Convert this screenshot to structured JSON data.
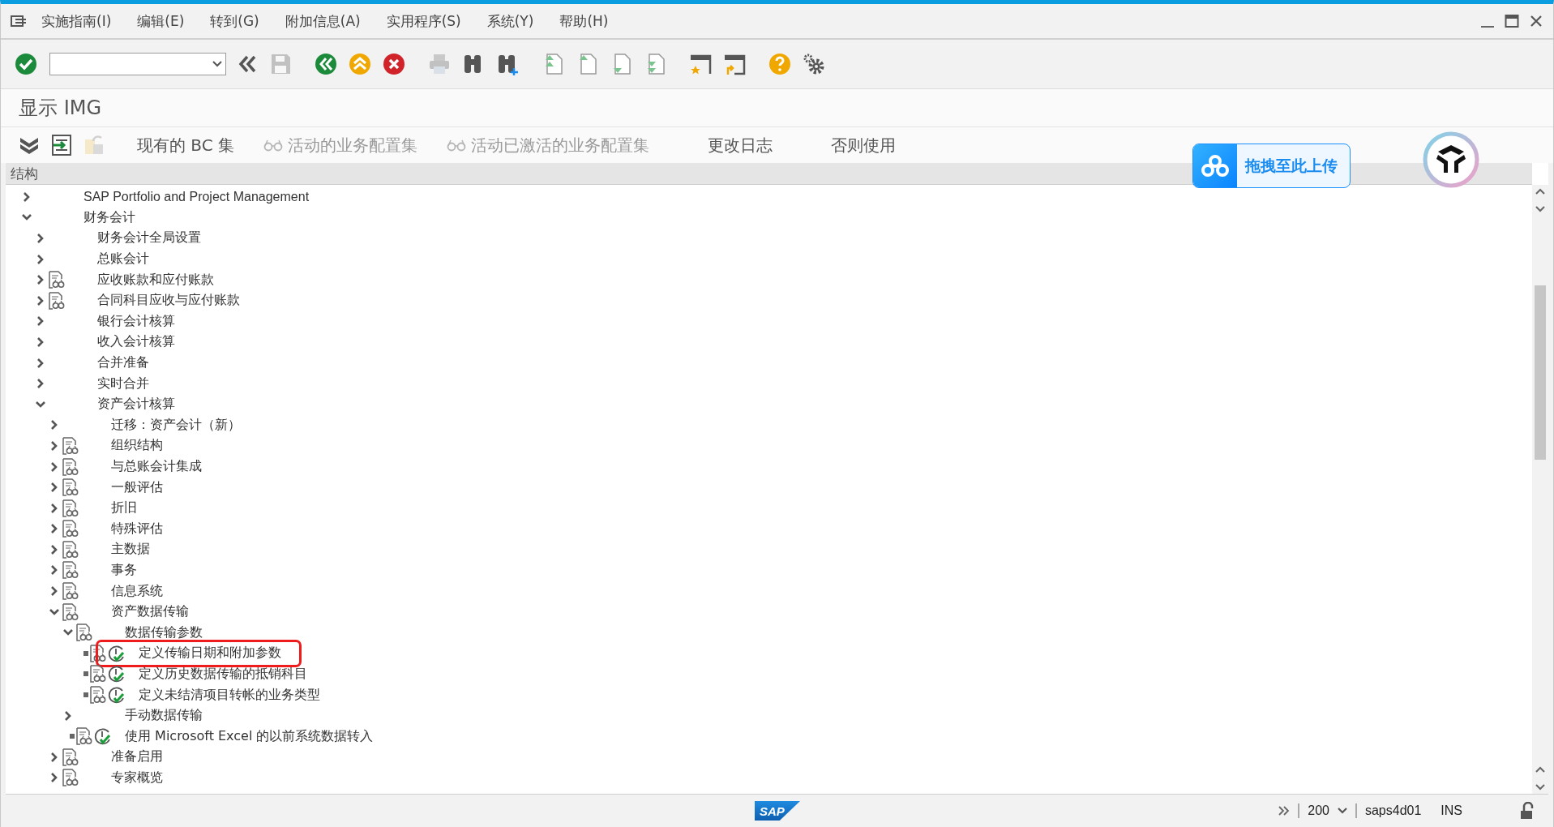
{
  "menu_bar": {
    "items": [
      "实施指南(I)",
      "编辑(E)",
      "转到(G)",
      "附加信息(A)",
      "实用程序(S)",
      "系统(Y)",
      "帮助(H)"
    ]
  },
  "toolbar": {
    "buttons": [
      {
        "kind": "enter",
        "disabled": false
      },
      {
        "kind": "command_field",
        "disabled": false
      },
      {
        "kind": "collapse",
        "disabled": false
      },
      {
        "kind": "save",
        "disabled": true
      },
      {
        "kind": "back",
        "disabled": false
      },
      {
        "kind": "exit",
        "disabled": false
      },
      {
        "kind": "cancel",
        "disabled": false
      },
      {
        "kind": "print",
        "disabled": true
      },
      {
        "kind": "find",
        "disabled": false
      },
      {
        "kind": "find_next",
        "disabled": false
      },
      {
        "kind": "first_page",
        "disabled": false
      },
      {
        "kind": "previous_page",
        "disabled": false
      },
      {
        "kind": "next_page",
        "disabled": false
      },
      {
        "kind": "last_page",
        "disabled": false
      },
      {
        "kind": "new_session",
        "disabled": false
      },
      {
        "kind": "shortcut",
        "disabled": false
      },
      {
        "kind": "help",
        "disabled": false
      },
      {
        "kind": "settings",
        "disabled": false
      }
    ]
  },
  "title": "显示 IMG",
  "app_toolbar": {
    "icon_buttons": [
      {
        "kind": "expand_all",
        "disabled": false
      },
      {
        "kind": "transfer",
        "disabled": false
      },
      {
        "kind": "export",
        "disabled": true
      }
    ],
    "buttons": [
      {
        "label": "现有的 BC 集",
        "kind": "text",
        "disabled": false
      },
      {
        "label": "活动的业务配置集",
        "kind": "with_icon",
        "disabled": true
      },
      {
        "label": "活动已激活的业务配置集",
        "kind": "with_icon",
        "disabled": true
      },
      {
        "label": "更改日志",
        "kind": "text",
        "disabled": false
      },
      {
        "label": "否则使用",
        "kind": "text",
        "disabled": false
      }
    ]
  },
  "upload_button": {
    "label": "拖拽至此上传"
  },
  "tree": {
    "header": "结构",
    "nodes": [
      {
        "label": "SAP Portfolio and Project Management",
        "kind": "folder",
        "expanded": false,
        "documentation": false,
        "highlighted": false
      },
      {
        "label": "财务会计",
        "kind": "folder",
        "expanded": true,
        "documentation": false,
        "highlighted": false,
        "children": [
          {
            "label": "财务会计全局设置",
            "kind": "folder",
            "expanded": false,
            "documentation": false,
            "highlighted": false
          },
          {
            "label": "总账会计",
            "kind": "folder",
            "expanded": false,
            "documentation": false,
            "highlighted": false
          },
          {
            "label": "应收账款和应付账款",
            "kind": "folder",
            "expanded": false,
            "documentation": true,
            "highlighted": false
          },
          {
            "label": "合同科目应收与应付账款",
            "kind": "folder",
            "expanded": false,
            "documentation": true,
            "highlighted": false
          },
          {
            "label": "银行会计核算",
            "kind": "folder",
            "expanded": false,
            "documentation": false,
            "highlighted": false
          },
          {
            "label": "收入会计核算",
            "kind": "folder",
            "expanded": false,
            "documentation": false,
            "highlighted": false
          },
          {
            "label": "合并准备",
            "kind": "folder",
            "expanded": false,
            "documentation": false,
            "highlighted": false
          },
          {
            "label": "实时合并",
            "kind": "folder",
            "expanded": false,
            "documentation": false,
            "highlighted": false
          },
          {
            "label": "资产会计核算",
            "kind": "folder",
            "expanded": true,
            "documentation": false,
            "highlighted": false,
            "children": [
              {
                "label": "迁移：资产会计（新）",
                "kind": "folder",
                "expanded": false,
                "documentation": false,
                "highlighted": false
              },
              {
                "label": "组织结构",
                "kind": "folder",
                "expanded": false,
                "documentation": true,
                "highlighted": false
              },
              {
                "label": "与总账会计集成",
                "kind": "folder",
                "expanded": false,
                "documentation": true,
                "highlighted": false
              },
              {
                "label": "一般评估",
                "kind": "folder",
                "expanded": false,
                "documentation": true,
                "highlighted": false
              },
              {
                "label": "折旧",
                "kind": "folder",
                "expanded": false,
                "documentation": true,
                "highlighted": false
              },
              {
                "label": "特殊评估",
                "kind": "folder",
                "expanded": false,
                "documentation": true,
                "highlighted": false
              },
              {
                "label": "主数据",
                "kind": "folder",
                "expanded": false,
                "documentation": true,
                "highlighted": false
              },
              {
                "label": "事务",
                "kind": "folder",
                "expanded": false,
                "documentation": true,
                "highlighted": false
              },
              {
                "label": "信息系统",
                "kind": "folder",
                "expanded": false,
                "documentation": true,
                "highlighted": false
              },
              {
                "label": "资产数据传输",
                "kind": "folder",
                "expanded": true,
                "documentation": true,
                "highlighted": false,
                "children": [
                  {
                    "label": "数据传输参数",
                    "kind": "folder",
                    "expanded": true,
                    "documentation": true,
                    "highlighted": false,
                    "children": [
                      {
                        "label": "定义传输日期和附加参数",
                        "kind": "activity",
                        "documentation": true,
                        "highlighted": true
                      },
                      {
                        "label": "定义历史数据传输的抵销科目",
                        "kind": "activity",
                        "documentation": true,
                        "highlighted": false
                      },
                      {
                        "label": "定义未结清项目转帐的业务类型",
                        "kind": "activity",
                        "documentation": true,
                        "highlighted": false
                      }
                    ]
                  },
                  {
                    "label": "手动数据传输",
                    "kind": "folder",
                    "expanded": false,
                    "documentation": false,
                    "highlighted": false
                  },
                  {
                    "label": "使用 Microsoft Excel 的以前系统数据转入",
                    "kind": "activity",
                    "documentation": true,
                    "highlighted": false
                  }
                ]
              },
              {
                "label": "准备启用",
                "kind": "folder",
                "expanded": false,
                "documentation": true,
                "highlighted": false
              },
              {
                "label": "专家概览",
                "kind": "folder",
                "expanded": false,
                "documentation": true,
                "highlighted": false
              }
            ]
          }
        ]
      }
    ]
  },
  "status_bar": {
    "logo": "SAP",
    "client": "200",
    "server": "saps4d01",
    "mode": "INS"
  }
}
